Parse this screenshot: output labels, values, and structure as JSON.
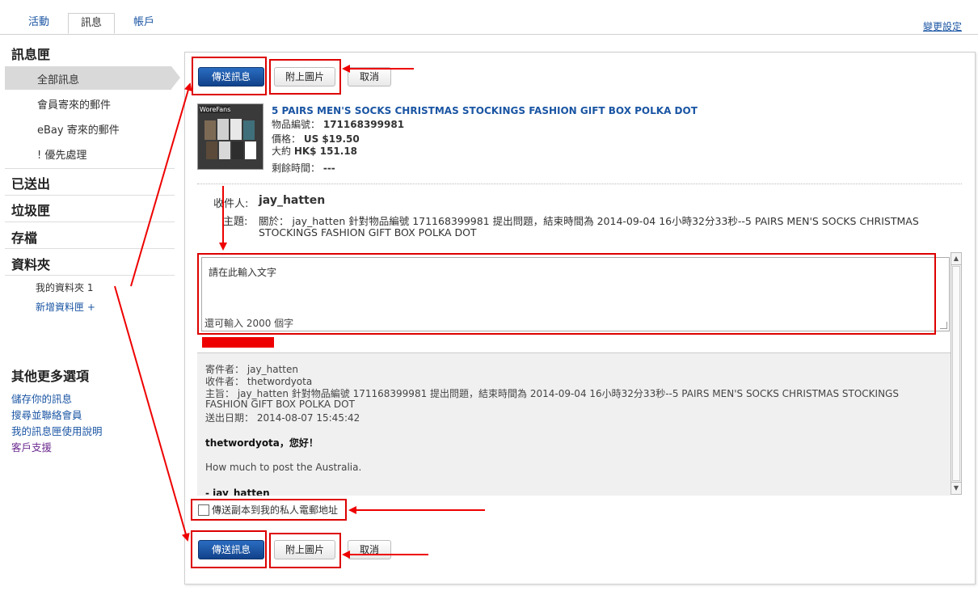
{
  "tabs": [
    {
      "label": "活動",
      "active": false
    },
    {
      "label": "訊息",
      "active": true
    },
    {
      "label": "帳戶",
      "active": false
    }
  ],
  "settings_link": "變更設定",
  "sidebar": {
    "inbox_heading": "訊息匣",
    "inbox_items": [
      "全部訊息",
      "會員寄來的郵件",
      "eBay 寄來的郵件",
      "! 優先處理"
    ],
    "sent": "已送出",
    "trash": "垃圾匣",
    "archive": "存檔",
    "folders_heading": "資料夾",
    "my_folder": "我的資料夾 1",
    "add_folder": "新增資料匣 +",
    "more_heading": "其他更多選項",
    "more_links": [
      "儲存你的訊息",
      "搜尋並聯絡會員",
      "我的訊息匣使用說明",
      "客戶支援"
    ]
  },
  "buttons": {
    "send": "傳送訊息",
    "attach": "附上圖片",
    "cancel": "取消"
  },
  "item": {
    "title": "5 PAIRS MEN'S SOCKS CHRISTMAS STOCKINGS FASHION GIFT BOX POLKA DOT",
    "number_label": "物品編號：",
    "number": "171168399981",
    "price_label": "價格：",
    "price": "US $19.50",
    "approx_label": "大約",
    "approx": "HK$ 151.18",
    "time_label": "剩餘時間：",
    "time": "---",
    "img_brand": "WoreFans"
  },
  "message": {
    "to_label": "收件人:",
    "to": "jay_hatten",
    "subject_label": "主題:",
    "subject_line1": "關於： jay_hatten 針對物品編號 171168399981 提出問題，結束時間為 2014-09-04 16小時32分33秒--5 PAIRS MEN'S SOCKS CHRISTMAS",
    "subject_line2": "STOCKINGS FASHION GIFT BOX POLKA DOT",
    "placeholder": "請在此輸入文字",
    "remaining": "還可輸入 2000 個字"
  },
  "quoted": {
    "from": "寄件者： jay_hatten",
    "to": "收件者： thetwordyota",
    "subject1": "主旨： jay_hatten 針對物品編號 171168399981 提出問題，結束時間為 2014-09-04 16小時32分33秒--5 PAIRS MEN'S SOCKS CHRISTMAS STOCKINGS",
    "subject2": "FASHION GIFT BOX POLKA DOT",
    "date": "送出日期： 2014-08-07 15:45:42",
    "greeting": "thetwordyota，您好！",
    "body": "How much to post the Australia.",
    "signature": "- jay_hatten"
  },
  "copy_checkbox": "傳送副本到我的私人電郵地址",
  "colors": {
    "link": "#1a55a3",
    "annotation": "#dd0000",
    "primary": "#11428a"
  }
}
